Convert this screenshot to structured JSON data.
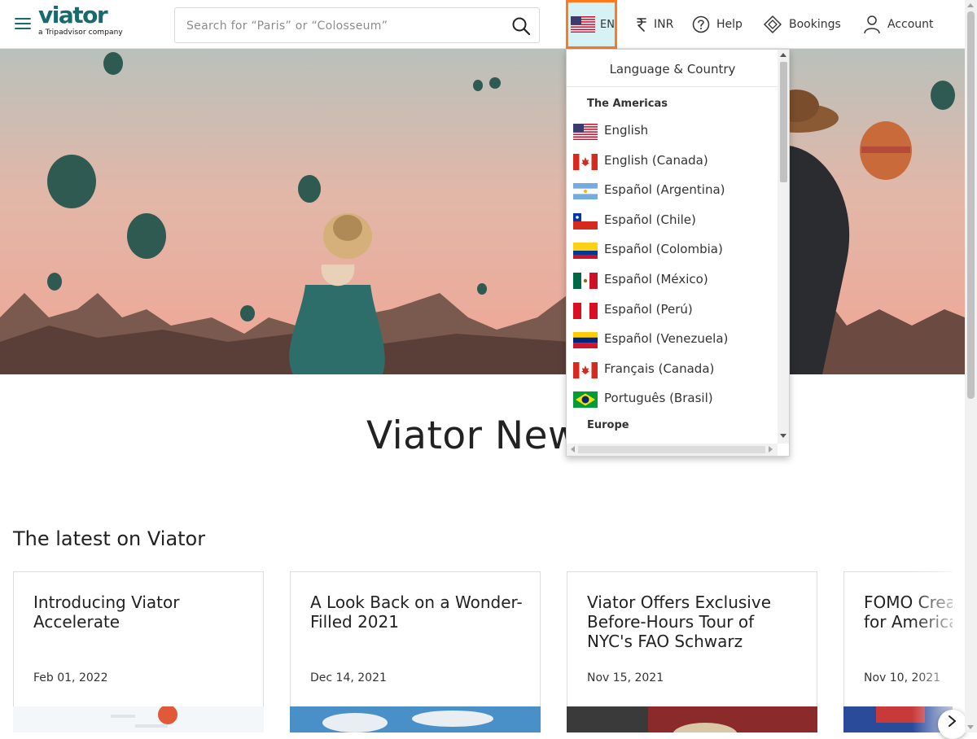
{
  "header": {
    "logo_text": "viator",
    "logo_subtext": "a Tripadvisor company",
    "search_placeholder": "Search for “Paris” or “Colosseum”",
    "language_code": "EN",
    "currency_label": "INR",
    "help_label": "Help",
    "bookings_label": "Bookings",
    "account_label": "Account"
  },
  "language_dropdown": {
    "title": "Language & Country",
    "regions": [
      {
        "name": "The Americas",
        "items": [
          {
            "label": "English",
            "flag": "us-flag-icon"
          },
          {
            "label": "English (Canada)",
            "flag": "canada-flag-icon"
          },
          {
            "label": "Español (Argentina)",
            "flag": "argentina-flag-icon"
          },
          {
            "label": "Español (Chile)",
            "flag": "chile-flag-icon"
          },
          {
            "label": "Español (Colombia)",
            "flag": "colombia-flag-icon"
          },
          {
            "label": "Español (México)",
            "flag": "mexico-flag-icon"
          },
          {
            "label": "Español (Perú)",
            "flag": "peru-flag-icon"
          },
          {
            "label": "Español (Venezuela)",
            "flag": "venezuela-flag-icon"
          },
          {
            "label": "Français (Canada)",
            "flag": "canada-flag-icon"
          },
          {
            "label": "Português (Brasil)",
            "flag": "brazil-flag-icon"
          }
        ]
      },
      {
        "name": "Europe",
        "items": []
      }
    ]
  },
  "main": {
    "page_title": "Viator Newsroom",
    "section_title": "The latest on Viator",
    "cards": [
      {
        "title": "Introducing Viator Accelerate",
        "date": "Feb 01, 2022"
      },
      {
        "title": "A Look Back on a Wonder-Filled 2021",
        "date": "Dec 14, 2021"
      },
      {
        "title": "Viator Offers Exclusive Before-Hours Tour of NYC's FAO Schwarz",
        "date": "Nov 15, 2021"
      },
      {
        "title": "FOMO Creates Demand for American Experiences",
        "date": "Nov 10, 2021"
      }
    ]
  },
  "colors": {
    "brand_teal": "#186b6d",
    "focus_orange": "#ff7a1a",
    "lang_button_bg": "#d6f2f5"
  }
}
